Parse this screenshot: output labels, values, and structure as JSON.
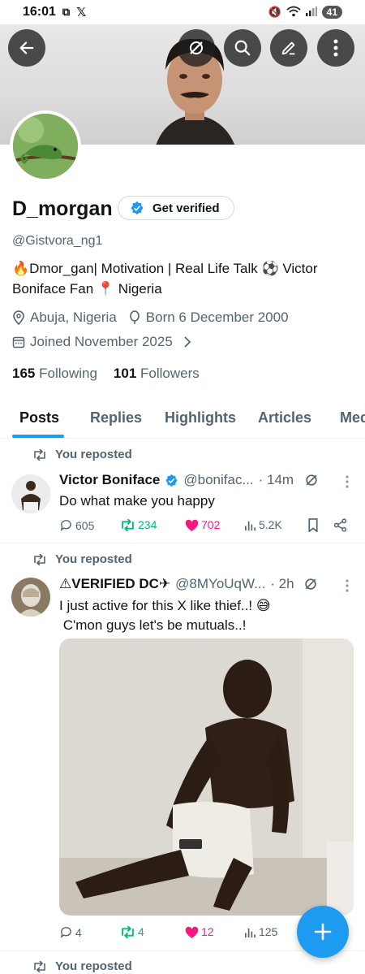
{
  "status": {
    "time": "16:01",
    "battery": "41"
  },
  "profile": {
    "name": "D_morgan",
    "get_verified": "Get verified",
    "handle": "@Gistvora_ng1",
    "bio_line1": "🔥Dmor_gan| Motivation | Real Life Talk ⚽ Victor",
    "bio_line2": "Boniface Fan 📍 Nigeria",
    "location": "Abuja, Nigeria",
    "born": "Born 6 December 2000",
    "joined": "Joined November 2025",
    "following_count": "165",
    "following_label": "Following",
    "followers_count": "101",
    "followers_label": "Followers"
  },
  "tabs": [
    "Posts",
    "Replies",
    "Highlights",
    "Articles",
    "Med"
  ],
  "posts": [
    {
      "repost_label": "You reposted",
      "author": "Victor Boniface",
      "handle": "@bonifac...",
      "time": "· 14m",
      "text": "Do what make you happy",
      "replies": "605",
      "reposts": "234",
      "likes": "702",
      "views": "5.2K"
    },
    {
      "repost_label": "You reposted",
      "author": "⚠VERIFIED DC✈",
      "handle": "@8MYoUqW...",
      "time": "· 2h",
      "text_line1": "I just active for this X like thief..! 😅",
      "text_line2": " C'mon guys let's be mutuals..!",
      "replies": "4",
      "reposts": "4",
      "likes": "12",
      "views": "125"
    },
    {
      "repost_label": "You reposted"
    }
  ],
  "colors": {
    "accent": "#1d9bf0",
    "repost": "#00ba7c",
    "like": "#f91880",
    "muted": "#536471"
  }
}
